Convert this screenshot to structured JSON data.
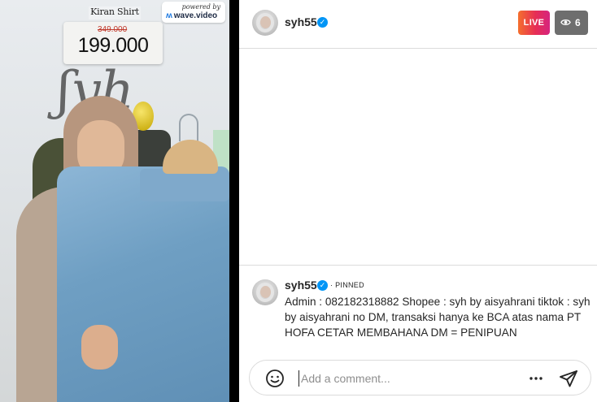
{
  "video": {
    "product_name": "Kiran Shirt",
    "price_old": "349.000",
    "price_new": "199.000",
    "powered_by_label": "powered by",
    "powered_by_brand": "wave.video"
  },
  "header": {
    "username": "syh55",
    "live_label": "LIVE",
    "viewer_count": "6"
  },
  "pinned_comment": {
    "username": "syh55",
    "pinned_label": "· PINNED",
    "text": "Admin : 082182318882 Shopee : syh by aisyahrani tiktok : syh by aisyahrani no DM, transaksi hanya ke BCA atas nama PT HOFA CETAR MEMBAHANA DM = PENIPUAN"
  },
  "comment_bar": {
    "placeholder": "Add a comment..."
  },
  "icons": {
    "verified": "verified-badge-icon",
    "eye": "eye-icon",
    "emoji": "smiley-icon",
    "more": "more-options-icon",
    "send": "send-icon"
  },
  "colors": {
    "live_gradient_start": "#f56f2d",
    "live_gradient_end": "#d6247f",
    "verified_blue": "#0095f6",
    "viewer_badge_bg": "#6e6e6e"
  }
}
